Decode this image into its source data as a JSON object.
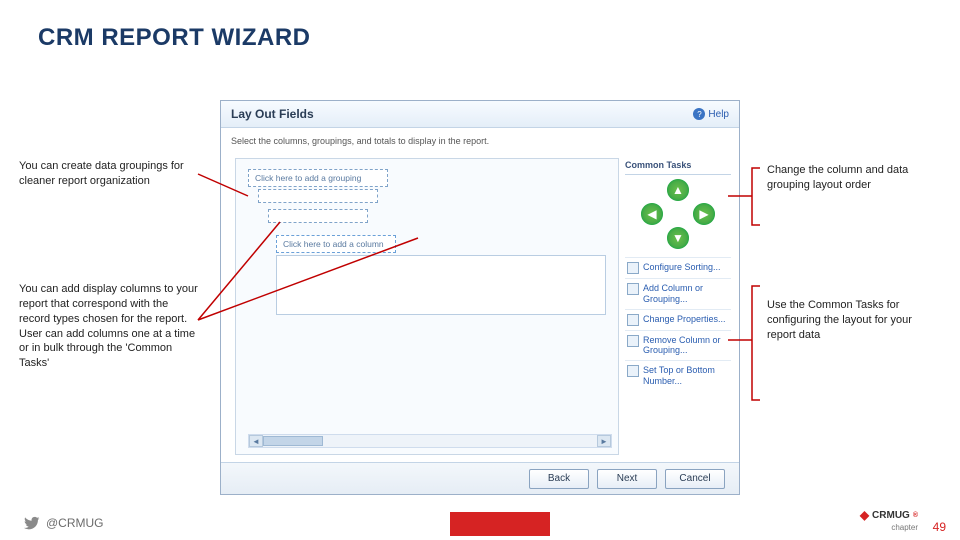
{
  "title": "CRM REPORT WIZARD",
  "callouts": {
    "left1": "You can create data groupings for cleaner report organization",
    "left2": "You can add display columns to your report that correspond with the record types chosen for the report. User can add columns one at a time or in bulk through the 'Common Tasks'",
    "right1": "Change the column and data grouping layout order",
    "right2": "Use the Common Tasks for configuring the layout for your report data"
  },
  "panel": {
    "title": "Lay Out Fields",
    "help": "Help",
    "desc": "Select the columns, groupings, and totals to display in the report.",
    "drops": {
      "grouping": "Click here to add a grouping",
      "column": "Click here to add a column"
    },
    "commonTasks": {
      "heading": "Common Tasks",
      "items": [
        "Configure Sorting...",
        "Add Column or Grouping...",
        "Change Properties...",
        "Remove Column or Grouping...",
        "Set Top or Bottom Number..."
      ]
    },
    "buttons": {
      "back": "Back",
      "next": "Next",
      "cancel": "Cancel"
    }
  },
  "footer": {
    "handle": "@CRMUG",
    "brand": "CRMUG",
    "chapter": "chapter",
    "page": "49"
  }
}
